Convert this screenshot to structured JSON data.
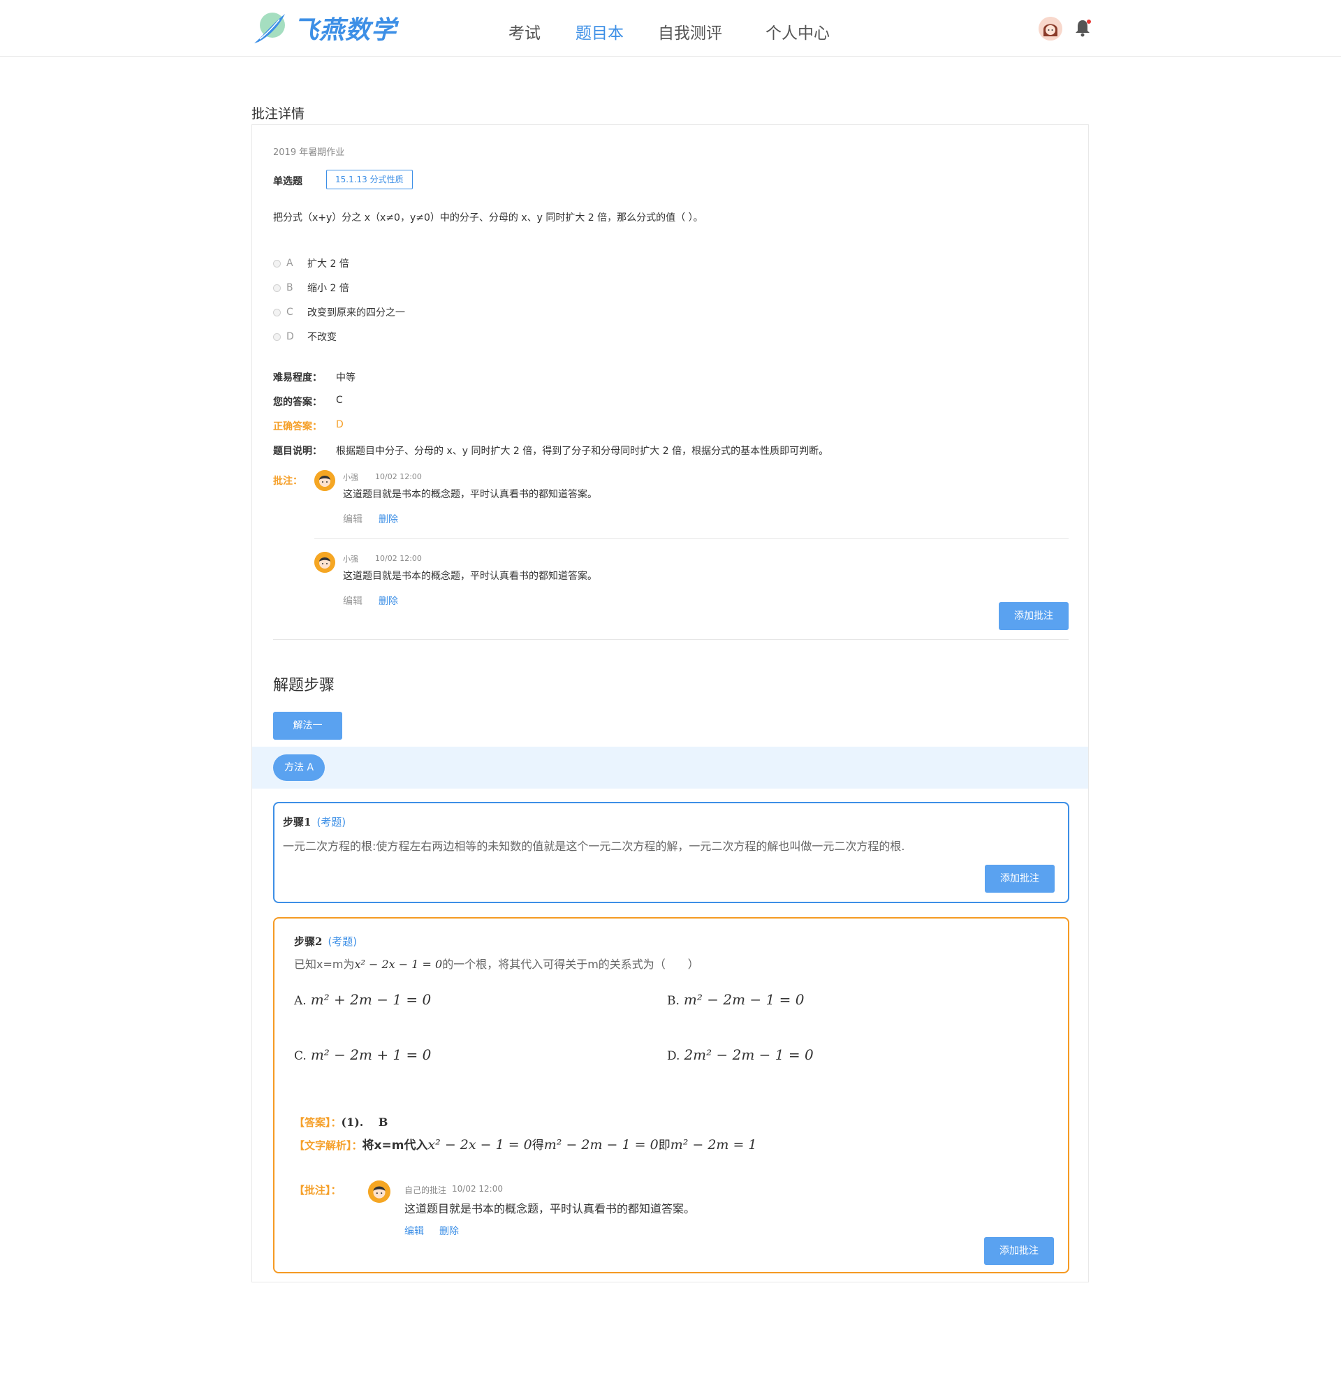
{
  "brand": {
    "logo_text": "飞燕数学"
  },
  "nav": [
    {
      "label": "考试",
      "active": false
    },
    {
      "label": "题目本",
      "active": true
    },
    {
      "label": "自我测评",
      "active": false
    },
    {
      "label": "个人中心",
      "active": false
    }
  ],
  "page": {
    "title": "批注详情"
  },
  "question": {
    "source": "2019 年暑期作业",
    "type": "单选题",
    "tag": "15.1.13  分式性质",
    "text": "把分式（x+y）分之 x（x≠0，y≠0）中的分子、分母的 x、y 同时扩大 2 倍，那么分式的值（  ）。",
    "options": [
      {
        "letter": "A",
        "text": "扩大 2 倍"
      },
      {
        "letter": "B",
        "text": "缩小 2 倍"
      },
      {
        "letter": "C",
        "text": "改变到原来的四分之一"
      },
      {
        "letter": "D",
        "text": "不改变"
      }
    ],
    "difficulty_label": "难易程度：",
    "difficulty": "中等",
    "your_answer_label": "您的答案：",
    "your_answer": "C",
    "correct_label": "正确答案：",
    "correct_answer": "D",
    "explain_label": "题目说明：",
    "explanation": "根据题目中分子、分母的 x、y 同时扩大 2 倍，得到了分子和分母同时扩大 2 倍，根据分式的基本性质即可判断。",
    "comments_label": "批注：",
    "comments": [
      {
        "author": "小强",
        "time": "10/02 12:00",
        "text": "这道题目就是书本的概念题，平时认真看书的都知道答案。",
        "edit": "编辑",
        "delete": "删除"
      },
      {
        "author": "小强",
        "time": "10/02 12:00",
        "text": "这道题目就是书本的概念题，平时认真看书的都知道答案。",
        "edit": "编辑",
        "delete": "删除"
      }
    ],
    "add_comment": "添加批注"
  },
  "steps": {
    "title": "解题步骤",
    "solution_tab": "解法一",
    "method": "方法 A",
    "step1": {
      "label": "步骤1",
      "tag": "(考题)",
      "text": "一元二次方程的根:使方程左右两边相等的未知数的值就是这个一元二次方程的解，一元二次方程的解也叫做一元二次方程的根.",
      "add_comment": "添加批注"
    },
    "step2": {
      "label": "步骤2",
      "tag": "(考题)",
      "stem_pre": "已知x=m为",
      "stem_math": "x² − 2x − 1 = 0",
      "stem_post": "的一个根，将其代入可得关于m的关系式为（　　）",
      "options": [
        {
          "letter": "A.",
          "expr": "m² + 2m − 1 = 0"
        },
        {
          "letter": "B.",
          "expr": "m² − 2m − 1 = 0"
        },
        {
          "letter": "C.",
          "expr": "m² − 2m + 1 = 0"
        },
        {
          "letter": "D.",
          "expr": "2m² − 2m − 1 = 0"
        }
      ],
      "answer_label": "【答案】：",
      "answer_value": "(1).　 B",
      "analysis_label": "【文字解析】：",
      "analysis_pre": "将x=m代入",
      "analysis_m1": "x² − 2x − 1 = 0",
      "analysis_mid1": "得",
      "analysis_m2": "m² − 2m − 1 = 0",
      "analysis_mid2": "即",
      "analysis_m3": "m² − 2m = 1",
      "comment_label": "【批注】：",
      "comment": {
        "author": "自己的批注",
        "time": "10/02 12:00",
        "text": "这道题目就是书本的概念题，平时认真看书的都知道答案。",
        "edit": "编辑",
        "delete": "删除"
      },
      "add_comment": "添加批注"
    }
  },
  "colors": {
    "accent": "#3d8fe6",
    "button": "#5aa2f0",
    "warning": "#f59a23",
    "band": "#eaf4fe"
  }
}
